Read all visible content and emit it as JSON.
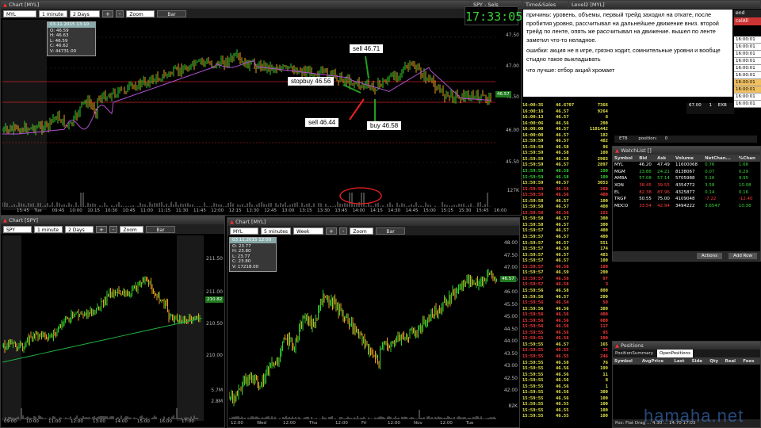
{
  "main_chart": {
    "title": "Chart [MYL]",
    "symbol": "MYL",
    "interval": "1 minute",
    "range": "2 Days",
    "zoom": "Zoom",
    "style": "Bar",
    "ohlc": {
      "date": "03.11.2015 13:10",
      "open": "O: 46.59",
      "high": "H: 46.63",
      "low": "L: 46.59",
      "close": "C: 46.62",
      "volume": "V: 44731.00"
    },
    "y_ticks": [
      "47.50",
      "47.00",
      "46.50",
      "46.00",
      "45.50"
    ],
    "x_ticks": [
      "15:45",
      "Tue",
      "09:45",
      "10:00",
      "10:15",
      "10:30",
      "10:45",
      "11:00",
      "11:15",
      "11:30",
      "11:45",
      "12:00",
      "12:15",
      "12:30",
      "12:45",
      "13:00",
      "13:15",
      "13:30",
      "13:45",
      "14:00",
      "14:15",
      "14:30",
      "14:45",
      "15:00",
      "15:15",
      "15:30",
      "15:45",
      "16:00"
    ],
    "volume_label": "127K",
    "last_price": "46.57",
    "annotations": {
      "sell1": "sell 46.71",
      "stopbuy": "stopbuy 46.56",
      "sell2": "sell 46.44",
      "buy": "buy 46.58"
    }
  },
  "clock": "17:33:05",
  "small_windows": {
    "ts_title": "SPY - Sels",
    "level2_title": "Level2 [MYL]"
  },
  "note": {
    "para1": "причины:   уровень, объемы, первый трейд заходил на откате, после пробития уровня, рассчитывал на дальнейшее движение вниз. второй трейд по ленте, опять же рассчитывал на движение. вышел по ленте заметил что-то неладное.",
    "para2": "ошибки:  акция не в игре, грязно ходит, сомнительные уровни и вообще стыдно такое выкладывать",
    "para3": "что лучше: отбор акций хромает"
  },
  "level2": {
    "buttons": [
      "end",
      "celAll"
    ],
    "times": [
      "16:00:01",
      "16:00:01",
      "16:00:01",
      "16:00:01",
      "16:00:01",
      "16:00:01",
      "16:00:01",
      "16:00:01",
      "16:00:01",
      "16:00:01"
    ],
    "row": {
      "price": "67.00",
      "size": "1",
      "exch": "EXB"
    },
    "etb": "ETB",
    "position_label": "position:",
    "position_value": "0"
  },
  "time_sales": {
    "rows": [
      [
        "16:00:35",
        "46.6707",
        "7366",
        "yellow"
      ],
      [
        "16:00:16",
        "46.57",
        "9264",
        "yellow"
      ],
      [
        "16:00:13",
        "46.57",
        "6",
        "yellow"
      ],
      [
        "16:00:06",
        "46.56",
        "200",
        "yellow"
      ],
      [
        "16:00:00",
        "46.57",
        "1101442",
        "yellow"
      ],
      [
        "16:00:00",
        "46.57",
        "182",
        "yellow"
      ],
      [
        "15:59:59",
        "46.57",
        "482",
        "yellow"
      ],
      [
        "15:59:59",
        "46.58",
        "96",
        "yellow"
      ],
      [
        "15:59:59",
        "46.58",
        "100",
        "yellow"
      ],
      [
        "15:59:59",
        "46.58",
        "2903",
        "yellow"
      ],
      [
        "15:59:59",
        "46.57",
        "2897",
        "yellow"
      ],
      [
        "15:59:59",
        "46.58",
        "100",
        "green"
      ],
      [
        "15:59:59",
        "46.58",
        "100",
        "green"
      ],
      [
        "15:59:59",
        "46.57",
        "3053",
        "yellow"
      ],
      [
        "15:59:59",
        "46.56",
        "260",
        "red"
      ],
      [
        "15:59:59",
        "46.56",
        "400",
        "red"
      ],
      [
        "15:59:58",
        "46.57",
        "100",
        "yellow"
      ],
      [
        "15:59:58",
        "46.57",
        "400",
        "yellow"
      ],
      [
        "15:59:58",
        "46.56",
        "155",
        "red"
      ],
      [
        "15:59:58",
        "46.57",
        "300",
        "yellow"
      ],
      [
        "15:59:58",
        "46.57",
        "300",
        "yellow"
      ],
      [
        "15:59:57",
        "46.57",
        "400",
        "yellow"
      ],
      [
        "15:59:57",
        "46.57",
        "400",
        "yellow"
      ],
      [
        "15:59:57",
        "46.57",
        "551",
        "yellow"
      ],
      [
        "15:59:57",
        "46.58",
        "174",
        "yellow"
      ],
      [
        "15:59:57",
        "46.57",
        "483",
        "yellow"
      ],
      [
        "15:59:57",
        "46.57",
        "100",
        "yellow"
      ],
      [
        "15:59:57",
        "46.56",
        "100",
        "red"
      ],
      [
        "15:59:57",
        "46.59",
        "200",
        "yellow"
      ],
      [
        "15:59:57",
        "46.58",
        "97",
        "red"
      ],
      [
        "15:59:57",
        "46.58",
        "3",
        "red"
      ],
      [
        "15:59:56",
        "46.58",
        "800",
        "yellow"
      ],
      [
        "15:59:56",
        "46.57",
        "200",
        "yellow"
      ],
      [
        "15:59:56",
        "46.54",
        "50",
        "red"
      ],
      [
        "15:59:56",
        "46.56",
        "380",
        "yellow"
      ],
      [
        "15:59:56",
        "46.56",
        "400",
        "red"
      ],
      [
        "15:59:56",
        "46.56",
        "600",
        "red"
      ],
      [
        "15:59:56",
        "46.56",
        "117",
        "red"
      ],
      [
        "15:59:55",
        "46.56",
        "95",
        "red"
      ],
      [
        "15:59:55",
        "46.56",
        "100",
        "red"
      ],
      [
        "15:59:55",
        "46.57",
        "165",
        "yellow"
      ],
      [
        "15:59:55",
        "46.55",
        "35",
        "red"
      ],
      [
        "15:59:55",
        "46.55",
        "246",
        "red"
      ],
      [
        "15:59:55",
        "46.58",
        "76",
        "yellow"
      ],
      [
        "15:59:55",
        "46.56",
        "199",
        "yellow"
      ],
      [
        "15:59:55",
        "46.56",
        "11",
        "yellow"
      ],
      [
        "15:59:55",
        "46.56",
        "8",
        "yellow"
      ],
      [
        "15:59:55",
        "46.56",
        "1",
        "yellow"
      ],
      [
        "15:59:55",
        "46.56",
        "300",
        "yellow"
      ],
      [
        "15:59:55",
        "46.56",
        "100",
        "yellow"
      ],
      [
        "15:59:55",
        "46.55",
        "100",
        "yellow"
      ],
      [
        "15:59:55",
        "46.55",
        "100",
        "yellow"
      ],
      [
        "15:59:55",
        "46.55",
        "100",
        "yellow"
      ]
    ]
  },
  "watchlist": {
    "title": "WatchList []",
    "columns": [
      "Symbol",
      "Bid",
      "Ask",
      "Volume",
      "NetChan...",
      "%Chan"
    ],
    "rows": [
      {
        "symbol": "MYL",
        "bid": "46.20",
        "ask": "47.49",
        "volume": "11600068",
        "net": "0.76",
        "pct": "1.66",
        "color": ""
      },
      {
        "symbol": "MGM",
        "bid": "23.86",
        "ask": "24.21",
        "volume": "8138067",
        "net": "0.07",
        "pct": "0.29",
        "color": "green"
      },
      {
        "symbol": "AMBA",
        "bid": "57.08",
        "ask": "57.14",
        "volume": "5705988",
        "net": "5.16",
        "pct": "9.95",
        "color": "green"
      },
      {
        "symbol": "XON",
        "bid": "38.45",
        "ask": "39.55",
        "volume": "4354772",
        "net": "3.58",
        "pct": "10.08",
        "color": "red"
      },
      {
        "symbol": "EL",
        "bid": "82.38",
        "ask": "87.96",
        "volume": "4325877",
        "net": "0.14",
        "pct": "0.16",
        "color": "red"
      },
      {
        "symbol": "TRGP",
        "bid": "50.55",
        "ask": "75.00",
        "volume": "4109048",
        "net": "-7.22",
        "pct": "-12.40",
        "color": ""
      },
      {
        "symbol": "MDCO",
        "bid": "33.54",
        "ask": "42.94",
        "volume": "3494222",
        "net": "3.6547",
        "pct": "10.36",
        "color": "red"
      }
    ],
    "actions": "Actions",
    "add_row": "Add Row"
  },
  "positions": {
    "title": "Positions",
    "tabs": [
      "PositionSummary",
      "OpenPositions"
    ],
    "columns": [
      "Symbol",
      "AvgPrice",
      "Last",
      "Side",
      "Qty",
      "Real",
      "Fees"
    ],
    "footer": "Pos:  Flat  Drag  ...  4.30  ...  14.70  17:03"
  },
  "spy_chart": {
    "title": "Chart [SPY]",
    "symbol": "SPY",
    "interval": "1 minute",
    "range": "2 Days",
    "zoom": "Zoom",
    "style": "Bar",
    "y_ticks": [
      "211.50",
      "211.00",
      "210.50",
      "210.00"
    ],
    "vol_ticks": [
      "5.7M",
      "2.8M"
    ],
    "x_ticks": [
      "09:00",
      "10:00",
      "11:00",
      "12:00",
      "13:00",
      "14:00",
      "15:00",
      "16:00",
      "17:00"
    ],
    "last_price": "210.82"
  },
  "myl5_chart": {
    "title": "Chart [MYL]",
    "symbol": "MYL",
    "interval": "5 minutes",
    "range": "Week",
    "zoom": "Zoom",
    "style": "Bar",
    "ohlc": {
      "date": "03.11.2015 12:00",
      "open": "O: 23.77",
      "high": "H: 23.80",
      "low": "L: 23.77",
      "close": "C: 23.80",
      "volume": "V: 17218.00"
    },
    "y_ticks": [
      "48.00",
      "47.50",
      "47.00",
      "46.50",
      "46.00",
      "45.50",
      "45.00",
      "44.50",
      "44.00",
      "43.50",
      "43.00",
      "42.50",
      "42.00"
    ],
    "vol_ticks": [
      "82K"
    ],
    "x_ticks": [
      "12:00",
      "Wed",
      "12:00",
      "Thu",
      "12:00",
      "Fri",
      "12:00",
      "Nov",
      "12:00",
      "Tue"
    ],
    "last_price": "46.57"
  },
  "watermark": "hamaha.net"
}
